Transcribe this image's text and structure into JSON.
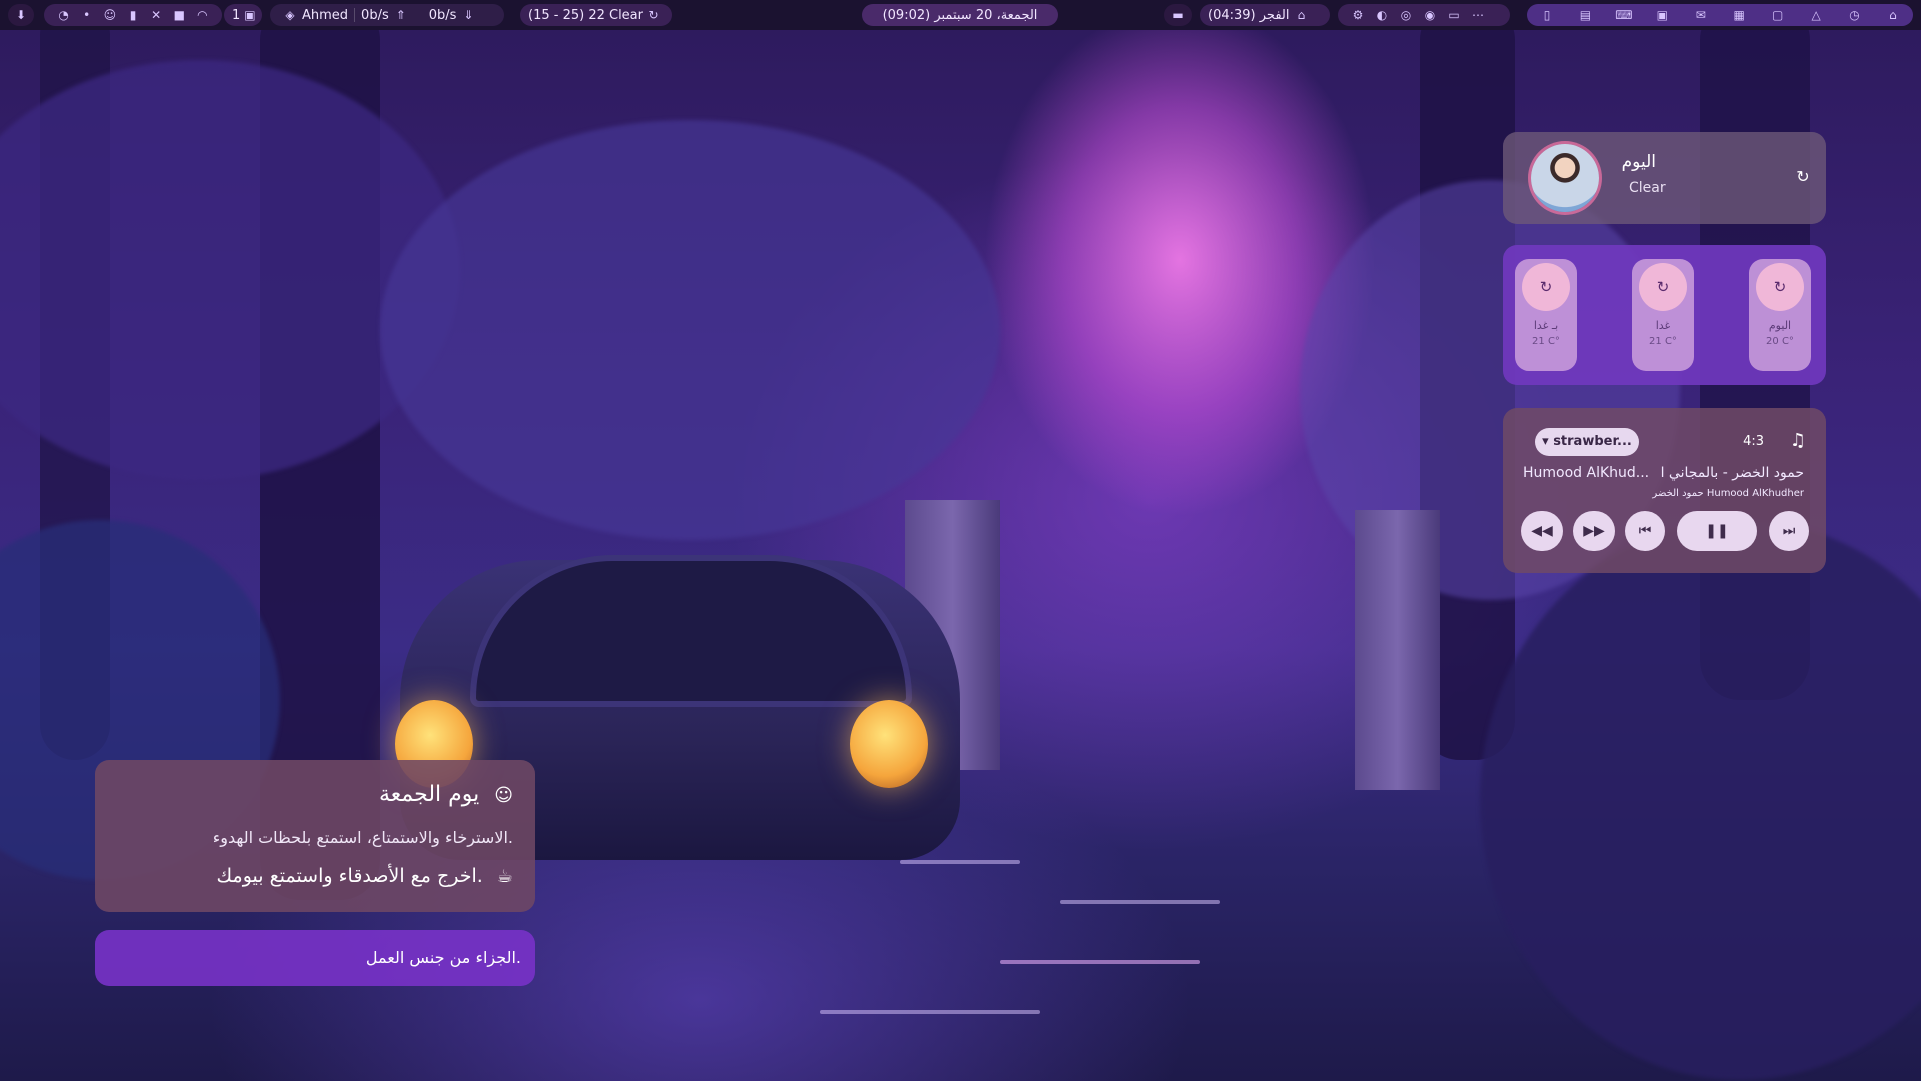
{
  "topbar": {
    "user": "Ahmed",
    "net_up": "0b/s",
    "net_down": "0b/s",
    "weather": "(15 - 25) 22 Clear",
    "workspace": "1",
    "datetime": "(09:02) الجمعة، 20 سبتمبر",
    "prayer": "الفجر (04:39)",
    "icons_left": [
      "download-icon",
      "browser-icon",
      "dot-icon",
      "discord-icon",
      "battery-icon",
      "tools-icon",
      "app-icon",
      "wifi-icon"
    ],
    "icons_right": [
      "settings-icon",
      "volume-icon",
      "mic-icon",
      "record-icon",
      "screen-icon",
      "more-icon"
    ],
    "icons_dock": [
      "phone-icon",
      "files-icon",
      "keyboard-icon",
      "folder-icon",
      "chat-icon",
      "doc-icon",
      "folder2-icon",
      "flask-icon",
      "clock-icon",
      "home-icon"
    ]
  },
  "weather_card": {
    "title": "اليوم",
    "condition": "Clear"
  },
  "forecast": [
    {
      "day": "بـ غدا",
      "temp": "21 C°"
    },
    {
      "day": "غدا",
      "temp": "21 C°"
    },
    {
      "day": "اليوم",
      "temp": "20 C°"
    }
  ],
  "player": {
    "source": "▾ strawber...",
    "time": "4:3",
    "title": "حمود الخضر - بالمجاني ا",
    "artist": "Humood AlKhud...",
    "subtitle": "حمود الخضر Humood AlKhudher"
  },
  "quote": {
    "heading": "يوم الجمعة",
    "line1": "الاسترخاء والاستمتاع، استمتع بلحظات الهدوء.",
    "line2": "اخرج مع الأصدقاء واستمتع بيومك."
  },
  "quote2": {
    "text": "الجزاء من جنس العمل."
  }
}
